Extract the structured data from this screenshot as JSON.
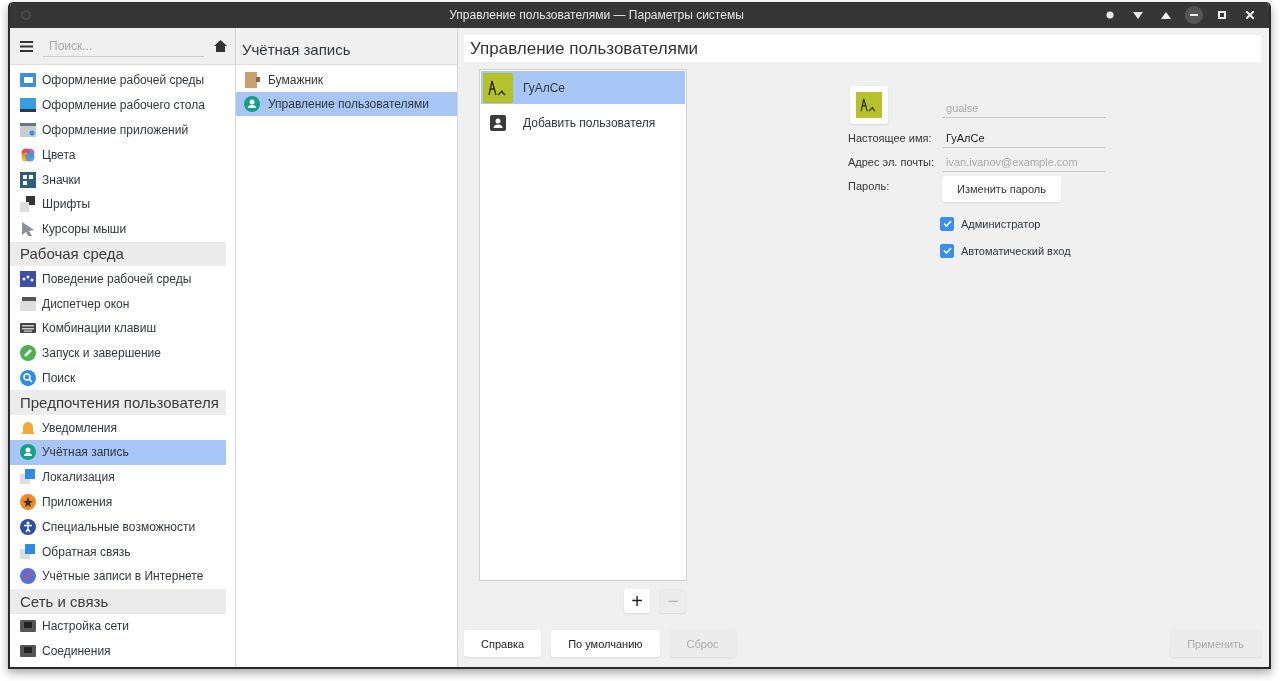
{
  "window": {
    "title": "Управление пользователями — Параметры системы"
  },
  "sidebar": {
    "search": {
      "placeholder": "Поиск..."
    },
    "items": [
      {
        "kind": "item",
        "label": "Оформление рабочей среды",
        "selected": false
      },
      {
        "kind": "item",
        "label": "Оформление рабочего стола",
        "selected": false
      },
      {
        "kind": "item",
        "label": "Оформление приложений",
        "selected": false
      },
      {
        "kind": "item",
        "label": "Цвета",
        "selected": false
      },
      {
        "kind": "item",
        "label": "Значки",
        "selected": false
      },
      {
        "kind": "item",
        "label": "Шрифты",
        "selected": false
      },
      {
        "kind": "item",
        "label": "Курсоры мыши",
        "selected": false
      },
      {
        "kind": "header",
        "label": "Рабочая среда"
      },
      {
        "kind": "item",
        "label": "Поведение рабочей среды",
        "selected": false
      },
      {
        "kind": "item",
        "label": "Диспетчер окон",
        "selected": false
      },
      {
        "kind": "item",
        "label": "Комбинации клавиш",
        "selected": false
      },
      {
        "kind": "item",
        "label": "Запуск и завершение",
        "selected": false
      },
      {
        "kind": "item",
        "label": "Поиск",
        "selected": false
      },
      {
        "kind": "header",
        "label": "Предпочтения пользователя"
      },
      {
        "kind": "item",
        "label": "Уведомления",
        "selected": false
      },
      {
        "kind": "item",
        "label": "Учётная запись",
        "selected": true
      },
      {
        "kind": "item",
        "label": "Локализация",
        "selected": false
      },
      {
        "kind": "item",
        "label": "Приложения",
        "selected": false
      },
      {
        "kind": "item",
        "label": "Специальные возможности",
        "selected": false
      },
      {
        "kind": "item",
        "label": "Обратная связь",
        "selected": false
      },
      {
        "kind": "item",
        "label": "Учётные записи в Интернете",
        "selected": false
      },
      {
        "kind": "header",
        "label": "Сеть и связь"
      },
      {
        "kind": "item",
        "label": "Настройка сети",
        "selected": false
      },
      {
        "kind": "item",
        "label": "Соединения",
        "selected": false
      }
    ]
  },
  "middle": {
    "title": "Учётная запись",
    "items": [
      {
        "label": "Бумажник",
        "selected": false
      },
      {
        "label": "Управление пользователями",
        "selected": true
      }
    ]
  },
  "main": {
    "title": "Управление пользователями",
    "users": [
      {
        "kind": "user",
        "name": "ГуАлСе",
        "selected": true
      },
      {
        "kind": "add",
        "name": "Добавить пользователя",
        "selected": false
      }
    ],
    "list_buttons": [
      {
        "label": "+",
        "disabled": false
      },
      {
        "label": "−",
        "disabled": true
      }
    ],
    "form": {
      "login": {
        "placeholder": "gualse"
      },
      "fields": [
        {
          "kind": "text",
          "label": "Настоящее имя:",
          "value": "ГуАлСе"
        },
        {
          "kind": "text",
          "label": "Адрес эл. почты:",
          "placeholder": "ivan.ivanov@example.com"
        },
        {
          "kind": "button",
          "label": "Пароль:",
          "button": "Изменить пароль"
        }
      ],
      "checkboxes": [
        {
          "label": "Администратор",
          "checked": true
        },
        {
          "label": "Автоматический вход",
          "checked": true
        }
      ]
    }
  },
  "footer": {
    "left_buttons": [
      {
        "label": "Справка",
        "disabled": false
      },
      {
        "label": "По умолчанию",
        "disabled": false
      },
      {
        "label": "Сброс",
        "disabled": true
      }
    ],
    "right_buttons": [
      {
        "label": "Применить",
        "disabled": true
      }
    ]
  }
}
